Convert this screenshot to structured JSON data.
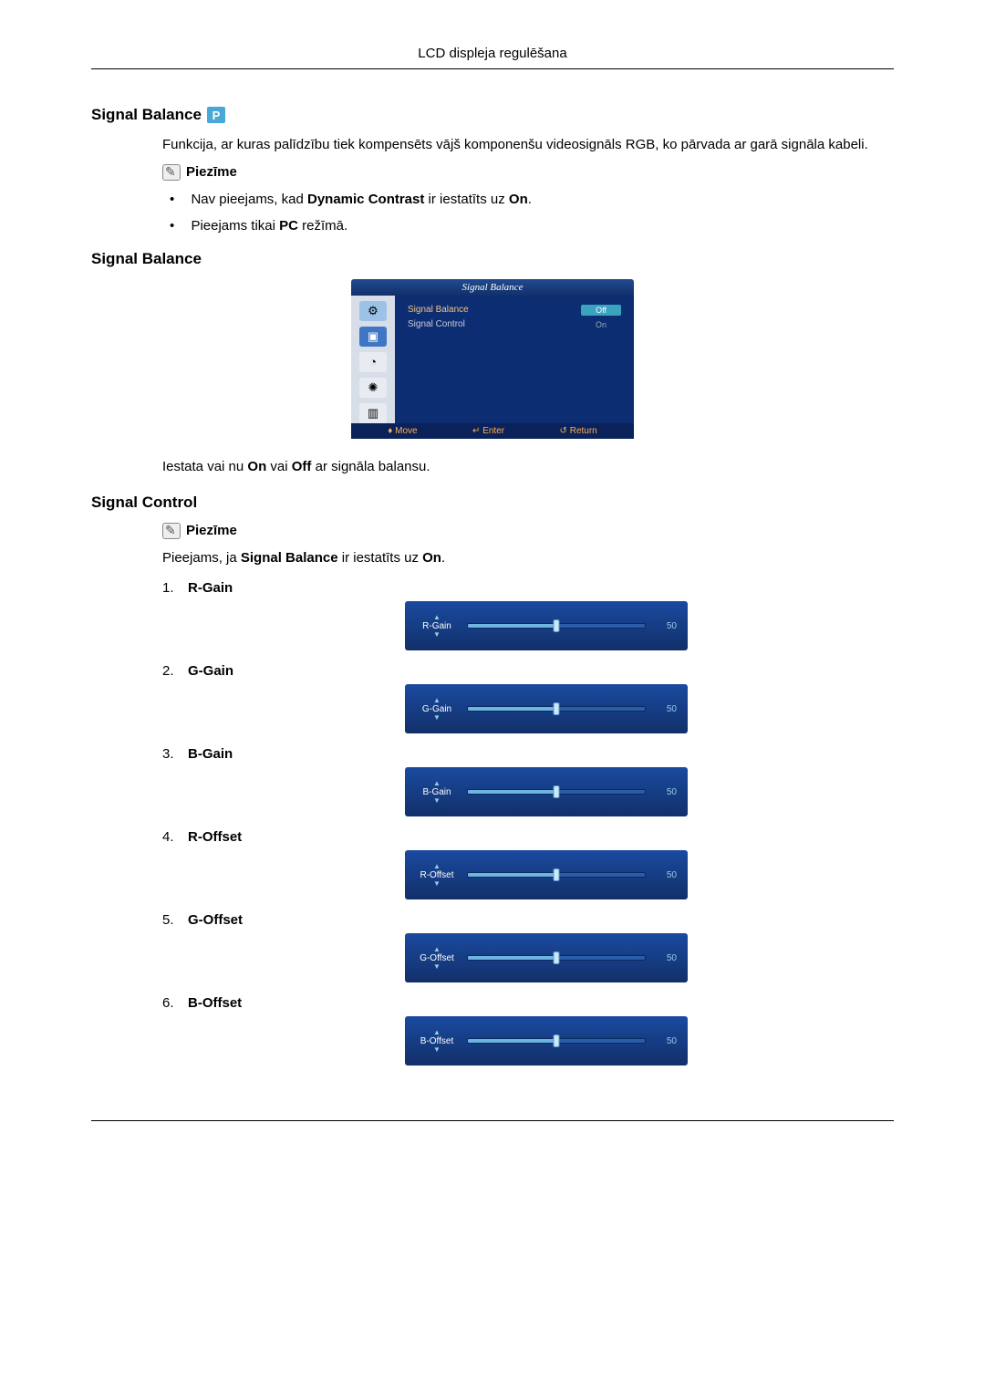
{
  "page_header": "LCD displeja regulēšana",
  "sections": {
    "signal_balance_main": {
      "title": "Signal Balance",
      "intro": "Funkcija, ar kuras palīdzību tiek kompensēts vājš komponenšu videosignāls RGB, ko pārvada ar garā signāla kabeli.",
      "note_label": "Piezīme",
      "bullet1_pre": "Nav pieejams, kad ",
      "bullet1_bold1": "Dynamic Contrast",
      "bullet1_mid": " ir iestatīts uz ",
      "bullet1_bold2": "On",
      "bullet1_post": ".",
      "bullet2_pre": "Pieejams tikai ",
      "bullet2_bold": "PC",
      "bullet2_post": " režīmā."
    },
    "signal_balance_sub": {
      "title": "Signal Balance",
      "desc_pre": "Iestata vai nu ",
      "desc_on": "On",
      "desc_mid": " vai ",
      "desc_off": "Off",
      "desc_post": " ar signāla balansu.",
      "osd": {
        "title": "Signal Balance",
        "items": [
          {
            "label": "Signal Balance",
            "value": "Off",
            "selected": true
          },
          {
            "label": "Signal Control",
            "value": "On",
            "selected": false
          }
        ],
        "footer": {
          "move": "Move",
          "enter": "Enter",
          "ret": "Return"
        }
      }
    },
    "signal_control": {
      "title": "Signal Control",
      "note_label": "Piezīme",
      "avail_pre": "Pieejams, ja ",
      "avail_bold": "Signal Balance",
      "avail_mid": " ir iestatīts uz ",
      "avail_on": "On",
      "avail_post": ".",
      "sliders": [
        {
          "num": "1.",
          "name": "R-Gain",
          "slider_label": "R-Gain",
          "value": "50"
        },
        {
          "num": "2.",
          "name": "G-Gain",
          "slider_label": "G-Gain",
          "value": "50"
        },
        {
          "num": "3.",
          "name": "B-Gain",
          "slider_label": "B-Gain",
          "value": "50"
        },
        {
          "num": "4.",
          "name": "R-Offset",
          "slider_label": "R-Offset",
          "value": "50"
        },
        {
          "num": "5.",
          "name": "G-Offset",
          "slider_label": "G-Offset",
          "value": "50"
        },
        {
          "num": "6.",
          "name": "B-Offset",
          "slider_label": "B-Offset",
          "value": "50"
        }
      ]
    }
  }
}
